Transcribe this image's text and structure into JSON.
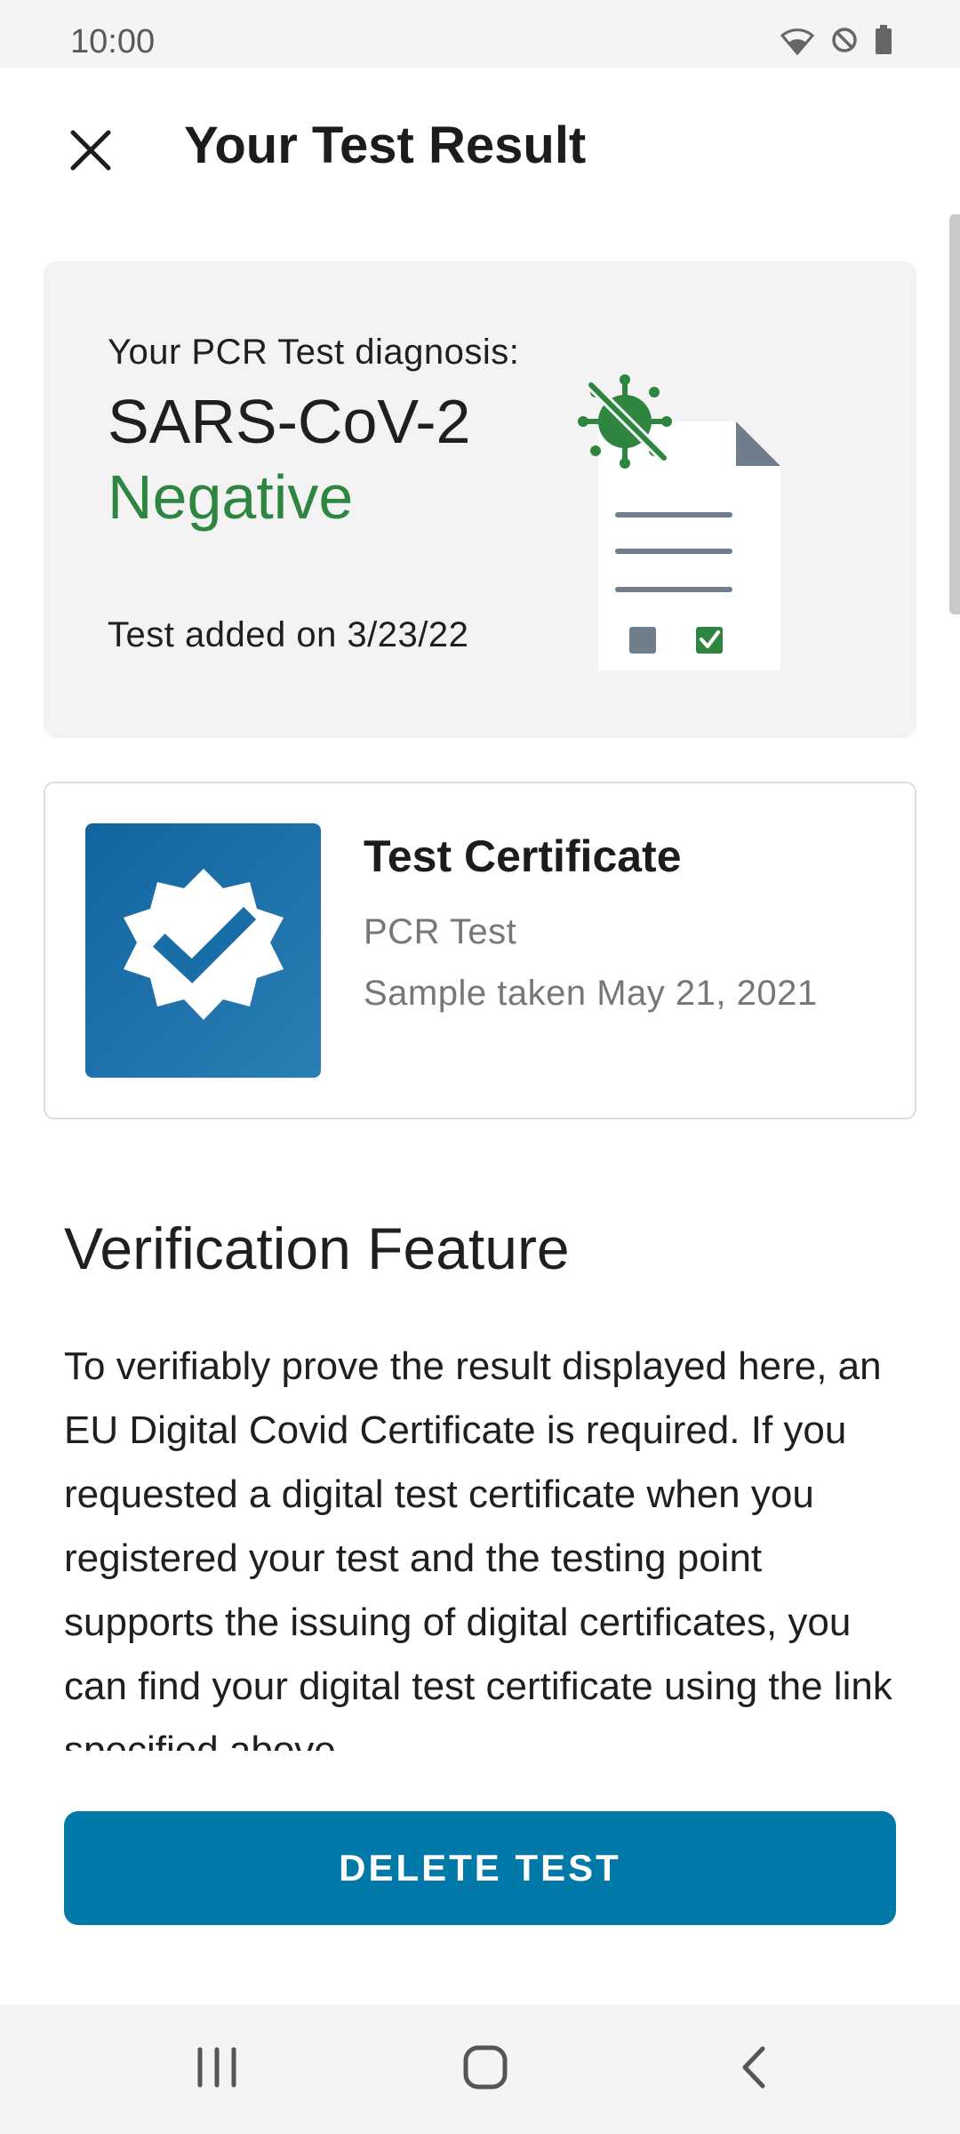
{
  "status_bar": {
    "time": "10:00",
    "icons": [
      "wifi-icon",
      "do-not-disturb-icon",
      "battery-icon"
    ]
  },
  "header": {
    "title": "Your Test Result",
    "close_icon": "close-icon"
  },
  "result_card": {
    "diagnosis_label": "Your PCR Test diagnosis:",
    "pathogen": "SARS-CoV-2",
    "status": "Negative",
    "added_date": "Test added on 3/23/22",
    "status_color": "#2e8540",
    "illustration_icon": "negative-test-document-icon"
  },
  "certificate_card": {
    "title": "Test Certificate",
    "test_type": "PCR Test",
    "sample_date": "Sample taken May 21, 2021",
    "icon": "certificate-badge-check-icon",
    "icon_bg": "#1a6ea8"
  },
  "verification": {
    "title": "Verification Feature",
    "body": "To verifiably prove the result displayed here, an EU Digital Covid Certificate is required. If you requested a digital test certificate when you registered your test and the testing point supports the issuing of digital certificates, you can find your digital test certificate using the link specified above."
  },
  "actions": {
    "delete_label": "DELETE TEST",
    "accent": "#0078a8"
  },
  "navigation": {
    "recents_icon": "recents-icon",
    "home_icon": "home-icon",
    "back_icon": "back-icon"
  }
}
